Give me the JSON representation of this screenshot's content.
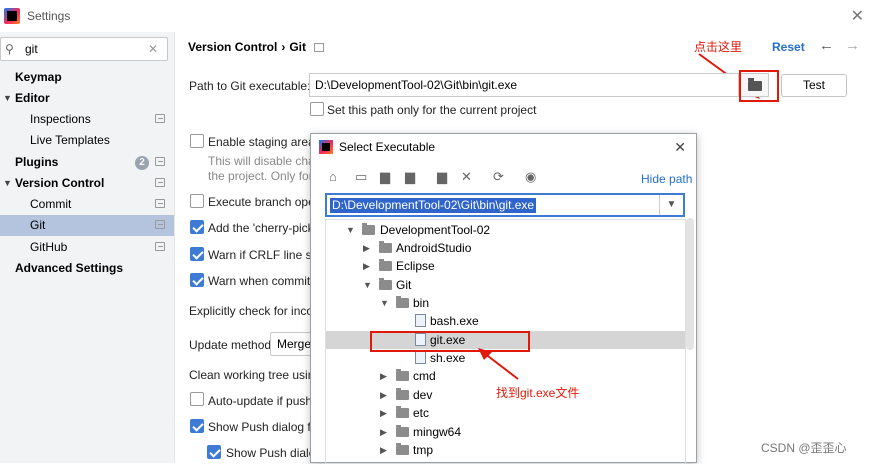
{
  "window": {
    "title": "Settings"
  },
  "search": {
    "query": "git"
  },
  "sidebar": {
    "items": [
      {
        "label": "Keymap"
      },
      {
        "label": "Editor"
      },
      {
        "label": "Inspections"
      },
      {
        "label": "Live Templates"
      },
      {
        "label": "Plugins",
        "badge": "2"
      },
      {
        "label": "Version Control"
      },
      {
        "label": "Commit"
      },
      {
        "label": "Git"
      },
      {
        "label": "GitHub"
      },
      {
        "label": "Advanced Settings"
      }
    ]
  },
  "header": {
    "crumb_parent": "Version Control",
    "crumb_sep": "›",
    "crumb_current": "Git",
    "reset_label": "Reset"
  },
  "annotations": {
    "click_here": "点击这里",
    "found": "找到git.exe文件"
  },
  "git": {
    "path_label": "Path to Git executable:",
    "path_value": "D:\\DevelopmentTool-02\\Git\\bin\\git.exe",
    "test_label": "Test",
    "current_project_only": "Set this path only for the current project",
    "enable_staging": "Enable staging area",
    "staging_desc1": "This will disable chang",
    "staging_desc2": "the project. Only for n",
    "execute_branch": "Execute branch opera",
    "add_cherry": "Add the 'cherry-picke",
    "warn_crlf": "Warn if CRLF line sep",
    "warn_committing": "Warn when committin",
    "explicit_check": "Explicitly check for incom",
    "update_method_label": "Update method:",
    "update_method_value": "Merge",
    "clean_tree": "Clean working tree using:",
    "auto_update": "Auto-update if push c",
    "show_push": "Show Push dialog for",
    "show_push2": "Show Push dialog"
  },
  "dialog": {
    "title": "Select Executable",
    "hide_path": "Hide path",
    "path_value": "D:\\DevelopmentTool-02\\Git\\bin\\git.exe",
    "tree": [
      {
        "label": "DevelopmentTool-02"
      },
      {
        "label": "AndroidStudio"
      },
      {
        "label": "Eclipse"
      },
      {
        "label": "Git"
      },
      {
        "label": "bin"
      },
      {
        "label": "bash.exe"
      },
      {
        "label": "git.exe"
      },
      {
        "label": "sh.exe"
      },
      {
        "label": "cmd"
      },
      {
        "label": "dev"
      },
      {
        "label": "etc"
      },
      {
        "label": "mingw64"
      },
      {
        "label": "tmp"
      }
    ]
  },
  "watermark": "CSDN @歪歪心",
  "colors": {
    "accent": "#2470c9",
    "selection": "#b4c4df",
    "annotation_red": "#e0190a",
    "checkbox_on": "#3d7bd4"
  }
}
